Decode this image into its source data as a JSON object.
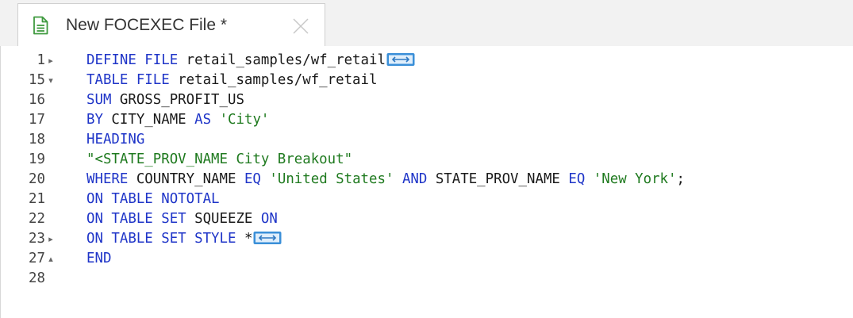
{
  "tab": {
    "title": "New FOCEXEC File *",
    "icon": "document-icon",
    "close_icon": "close-icon"
  },
  "colors": {
    "keyword": "#1f35c8",
    "string": "#1f7a1f",
    "plain": "#1a1a1a",
    "line_number": "#444444",
    "fold_widget": "#3a8fd8"
  },
  "lines": [
    {
      "num": "1",
      "fold": "collapsed",
      "tokens": [
        [
          "kw",
          "DEFINE FILE"
        ],
        [
          "pl",
          " retail_samples/wf_retail"
        ]
      ],
      "folded_widget": true
    },
    {
      "num": "15",
      "fold": "expanded",
      "tokens": [
        [
          "kw",
          "TABLE FILE"
        ],
        [
          "pl",
          " retail_samples/wf_retail"
        ]
      ]
    },
    {
      "num": "16",
      "fold": "",
      "tokens": [
        [
          "kw",
          "SUM"
        ],
        [
          "pl",
          " GROSS_PROFIT_US"
        ]
      ]
    },
    {
      "num": "17",
      "fold": "",
      "tokens": [
        [
          "kw",
          "BY"
        ],
        [
          "pl",
          " CITY_NAME "
        ],
        [
          "kw",
          "AS"
        ],
        [
          "pl",
          " "
        ],
        [
          "st",
          "'City'"
        ]
      ]
    },
    {
      "num": "18",
      "fold": "",
      "tokens": [
        [
          "kw",
          "HEADING"
        ]
      ]
    },
    {
      "num": "19",
      "fold": "",
      "tokens": [
        [
          "st",
          "\"<STATE_PROV_NAME City Breakout\""
        ]
      ]
    },
    {
      "num": "20",
      "fold": "",
      "tokens": [
        [
          "kw",
          "WHERE"
        ],
        [
          "pl",
          " COUNTRY_NAME "
        ],
        [
          "kw",
          "EQ"
        ],
        [
          "pl",
          " "
        ],
        [
          "st",
          "'United States'"
        ],
        [
          "pl",
          " "
        ],
        [
          "kw",
          "AND"
        ],
        [
          "pl",
          " STATE_PROV_NAME "
        ],
        [
          "kw",
          "EQ"
        ],
        [
          "pl",
          " "
        ],
        [
          "st",
          "'New York'"
        ],
        [
          "pl",
          ";"
        ]
      ]
    },
    {
      "num": "21",
      "fold": "",
      "tokens": [
        [
          "kw",
          "ON TABLE NOTOTAL"
        ]
      ]
    },
    {
      "num": "22",
      "fold": "",
      "tokens": [
        [
          "kw",
          "ON TABLE SET"
        ],
        [
          "pl",
          " SQUEEZE "
        ],
        [
          "kw",
          "ON"
        ]
      ]
    },
    {
      "num": "23",
      "fold": "collapsed",
      "tokens": [
        [
          "kw",
          "ON TABLE SET STYLE"
        ],
        [
          "pl",
          " *"
        ]
      ],
      "folded_widget": true
    },
    {
      "num": "27",
      "fold": "end",
      "tokens": [
        [
          "kw",
          "END"
        ]
      ]
    },
    {
      "num": "28",
      "fold": "",
      "tokens": []
    }
  ]
}
